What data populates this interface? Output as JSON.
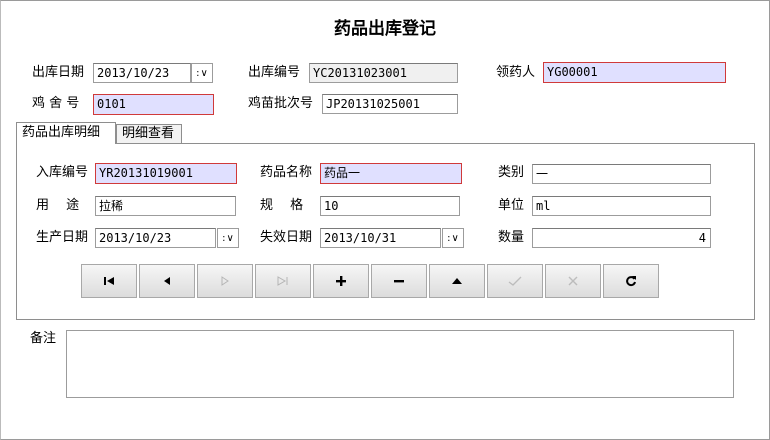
{
  "window": {
    "title": "药品出库登记"
  },
  "header": {
    "out_date_label": "出库日期",
    "out_date_value": "2013/10/23",
    "out_no_label": "出库编号",
    "out_no_value": "YC20131023001",
    "receiver_label": "领药人",
    "receiver_value": "YG00001",
    "coop_label": "鸡 舍 号",
    "coop_value": "0101",
    "batch_label": "鸡苗批次号",
    "batch_value": "JP20131025001"
  },
  "tabs": [
    {
      "label": "药品出库明细",
      "active": true
    },
    {
      "label": "明细查看",
      "active": false
    }
  ],
  "detail": {
    "in_no_label": "入库编号",
    "in_no_value": "YR20131019001",
    "drug_name_label": "药品名称",
    "drug_name_value": "药品一",
    "category_label": "类别",
    "category_value": "一",
    "usage_label": "用　 途",
    "usage_value": "拉稀",
    "spec_label": "规　 格",
    "spec_value": "10",
    "unit_label": "单位",
    "unit_value": "ml",
    "prod_date_label": "生产日期",
    "prod_date_value": "2013/10/23",
    "expiry_label": "失效日期",
    "expiry_value": "2013/10/31",
    "qty_label": "数量",
    "qty_value": "4"
  },
  "nav_buttons": [
    {
      "icon": "first-record-icon",
      "enabled": true
    },
    {
      "icon": "prior-record-icon",
      "enabled": true
    },
    {
      "icon": "next-record-icon",
      "enabled": false
    },
    {
      "icon": "last-record-icon",
      "enabled": false
    },
    {
      "icon": "insert-icon",
      "enabled": true
    },
    {
      "icon": "delete-icon",
      "enabled": true
    },
    {
      "icon": "edit-icon",
      "enabled": true
    },
    {
      "icon": "post-icon",
      "enabled": false
    },
    {
      "icon": "cancel-icon",
      "enabled": false
    },
    {
      "icon": "refresh-icon",
      "enabled": true
    }
  ],
  "memo": {
    "label": "备注",
    "value": ""
  },
  "colors": {
    "required_border": "#d03a3a",
    "required_fill": "#e0e0ff"
  }
}
